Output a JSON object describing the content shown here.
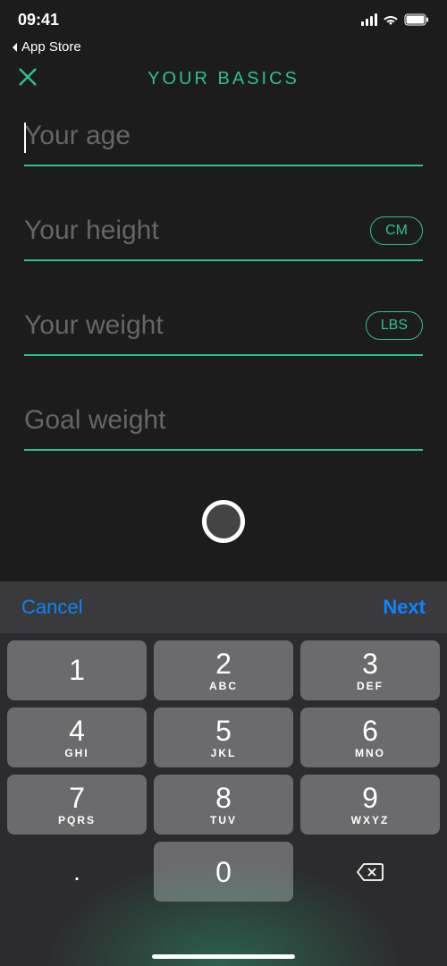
{
  "status": {
    "time": "09:41",
    "back_to": "App Store"
  },
  "header": {
    "title": "YOUR BASICS"
  },
  "fields": {
    "age": {
      "placeholder": "Your age",
      "value": ""
    },
    "height": {
      "placeholder": "Your height",
      "value": "",
      "unit": "CM"
    },
    "weight": {
      "placeholder": "Your weight",
      "value": "",
      "unit": "LBS"
    },
    "goal": {
      "placeholder": "Goal weight",
      "value": ""
    }
  },
  "keyboard": {
    "cancel": "Cancel",
    "next": "Next",
    "keys": {
      "k1": {
        "digit": "1",
        "letters": ""
      },
      "k2": {
        "digit": "2",
        "letters": "ABC"
      },
      "k3": {
        "digit": "3",
        "letters": "DEF"
      },
      "k4": {
        "digit": "4",
        "letters": "GHI"
      },
      "k5": {
        "digit": "5",
        "letters": "JKL"
      },
      "k6": {
        "digit": "6",
        "letters": "MNO"
      },
      "k7": {
        "digit": "7",
        "letters": "PQRS"
      },
      "k8": {
        "digit": "8",
        "letters": "TUV"
      },
      "k9": {
        "digit": "9",
        "letters": "WXYZ"
      },
      "k0": {
        "digit": "0",
        "letters": ""
      },
      "dot": {
        "digit": ".",
        "letters": ""
      }
    }
  }
}
